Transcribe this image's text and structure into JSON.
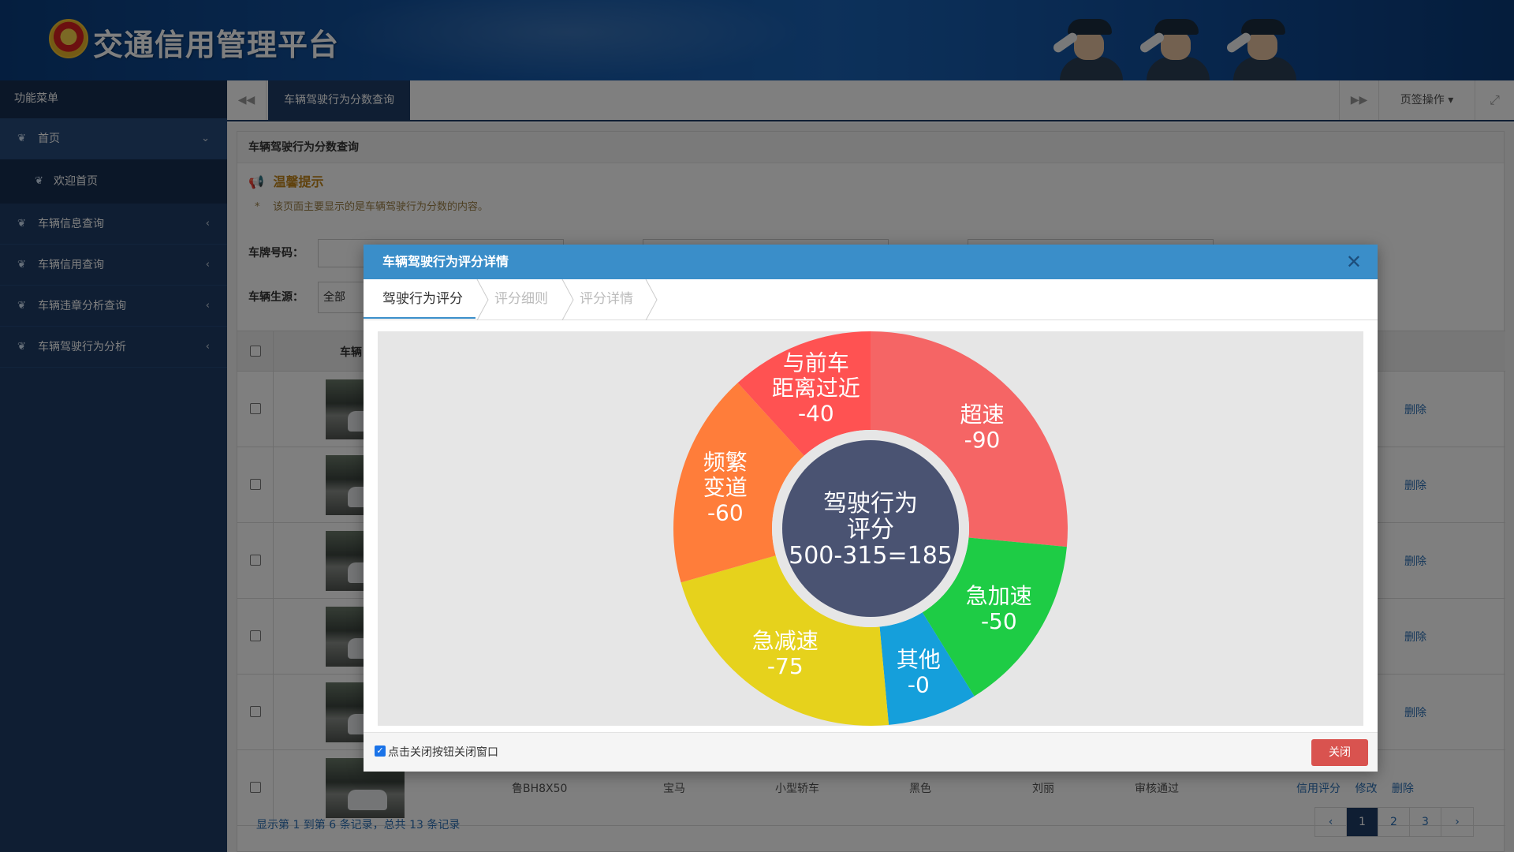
{
  "header": {
    "title": "交通信用管理平台"
  },
  "sidebar": {
    "heading": "功能菜单",
    "items": [
      {
        "label": "首页",
        "expanded": true,
        "children": [
          {
            "label": "欢迎首页"
          }
        ]
      },
      {
        "label": "车辆信息查询"
      },
      {
        "label": "车辆信用查询"
      },
      {
        "label": "车辆违章分析查询"
      },
      {
        "label": "车辆驾驶行为分析"
      }
    ]
  },
  "tabs": {
    "active": "车辆驾驶行为分数查询",
    "ops_label": "页签操作"
  },
  "page": {
    "panel_title": "车辆驾驶行为分数查询",
    "tips_title": "温馨提示",
    "tips_text": "该页面主要显示的是车辆驾驶行为分数的内容。",
    "filters": {
      "plate_label": "车牌号码：",
      "source_label": "车辆生源：",
      "source_value": "全部"
    },
    "table": {
      "first_header": "车辆",
      "last_row": {
        "plate": "鲁BH8X50",
        "brand": "宝马",
        "type": "小型轿车",
        "color": "黑色",
        "owner": "刘丽",
        "status": "审核通过"
      },
      "ops": {
        "score": "信用评分",
        "edit": "修改",
        "delete": "删除"
      }
    },
    "pager": {
      "info": "显示第 1 到第 6 条记录，总共 13 条记录",
      "prev": "‹",
      "pages": [
        "1",
        "2",
        "3"
      ],
      "next": "›",
      "current": "1"
    }
  },
  "modal": {
    "title": "车辆驾驶行为评分详情",
    "steps": [
      "驾驶行为评分",
      "评分细则",
      "评分详情"
    ],
    "footer_checkbox_label": "点击关闭按钮关闭窗口",
    "close_label": "关闭"
  },
  "chart_data": {
    "type": "pie",
    "center_text": [
      "驾驶行为",
      "评分",
      "500-315=185"
    ],
    "slices": [
      {
        "label": [
          "超速",
          "-90"
        ],
        "value": 90,
        "color": "#f56565"
      },
      {
        "label": [
          "急加速",
          "-50"
        ],
        "value": 50,
        "color": "#1ecc45"
      },
      {
        "label": [
          "其他",
          "-0"
        ],
        "value": 0,
        "color": "#159fdb"
      },
      {
        "label": [
          "急减速",
          "-75"
        ],
        "value": 75,
        "color": "#e6d21c"
      },
      {
        "label": [
          "频繁",
          "变道",
          "-60"
        ],
        "value": 60,
        "color": "#ff7d3a"
      },
      {
        "label": [
          "与前车",
          "距离过近",
          "-40"
        ],
        "value": 40,
        "color": "#ff5252"
      }
    ]
  }
}
